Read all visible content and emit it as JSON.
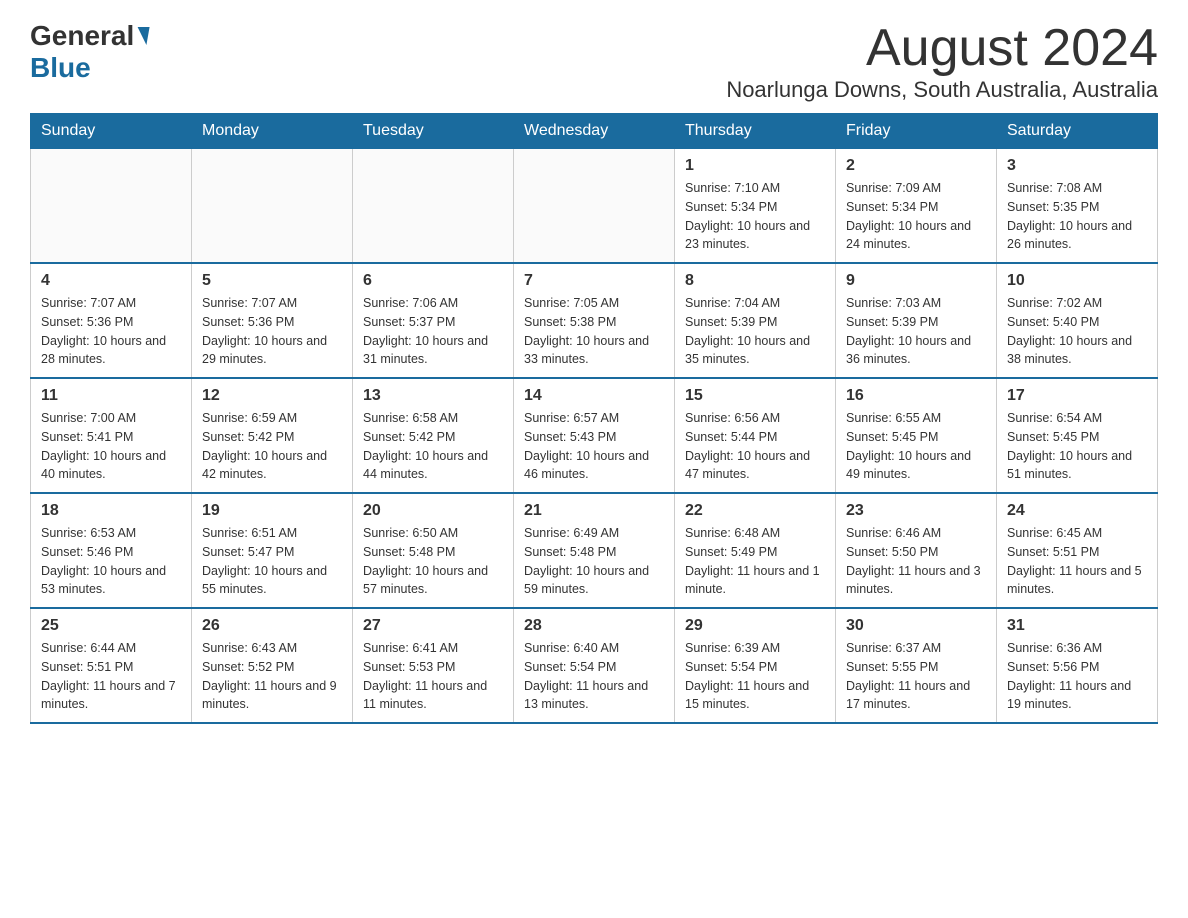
{
  "header": {
    "logo_general": "General",
    "logo_blue": "Blue",
    "month_title": "August 2024",
    "location": "Noarlunga Downs, South Australia, Australia"
  },
  "days_of_week": [
    "Sunday",
    "Monday",
    "Tuesday",
    "Wednesday",
    "Thursday",
    "Friday",
    "Saturday"
  ],
  "weeks": [
    [
      {
        "day": "",
        "info": ""
      },
      {
        "day": "",
        "info": ""
      },
      {
        "day": "",
        "info": ""
      },
      {
        "day": "",
        "info": ""
      },
      {
        "day": "1",
        "info": "Sunrise: 7:10 AM\nSunset: 5:34 PM\nDaylight: 10 hours and 23 minutes."
      },
      {
        "day": "2",
        "info": "Sunrise: 7:09 AM\nSunset: 5:34 PM\nDaylight: 10 hours and 24 minutes."
      },
      {
        "day": "3",
        "info": "Sunrise: 7:08 AM\nSunset: 5:35 PM\nDaylight: 10 hours and 26 minutes."
      }
    ],
    [
      {
        "day": "4",
        "info": "Sunrise: 7:07 AM\nSunset: 5:36 PM\nDaylight: 10 hours and 28 minutes."
      },
      {
        "day": "5",
        "info": "Sunrise: 7:07 AM\nSunset: 5:36 PM\nDaylight: 10 hours and 29 minutes."
      },
      {
        "day": "6",
        "info": "Sunrise: 7:06 AM\nSunset: 5:37 PM\nDaylight: 10 hours and 31 minutes."
      },
      {
        "day": "7",
        "info": "Sunrise: 7:05 AM\nSunset: 5:38 PM\nDaylight: 10 hours and 33 minutes."
      },
      {
        "day": "8",
        "info": "Sunrise: 7:04 AM\nSunset: 5:39 PM\nDaylight: 10 hours and 35 minutes."
      },
      {
        "day": "9",
        "info": "Sunrise: 7:03 AM\nSunset: 5:39 PM\nDaylight: 10 hours and 36 minutes."
      },
      {
        "day": "10",
        "info": "Sunrise: 7:02 AM\nSunset: 5:40 PM\nDaylight: 10 hours and 38 minutes."
      }
    ],
    [
      {
        "day": "11",
        "info": "Sunrise: 7:00 AM\nSunset: 5:41 PM\nDaylight: 10 hours and 40 minutes."
      },
      {
        "day": "12",
        "info": "Sunrise: 6:59 AM\nSunset: 5:42 PM\nDaylight: 10 hours and 42 minutes."
      },
      {
        "day": "13",
        "info": "Sunrise: 6:58 AM\nSunset: 5:42 PM\nDaylight: 10 hours and 44 minutes."
      },
      {
        "day": "14",
        "info": "Sunrise: 6:57 AM\nSunset: 5:43 PM\nDaylight: 10 hours and 46 minutes."
      },
      {
        "day": "15",
        "info": "Sunrise: 6:56 AM\nSunset: 5:44 PM\nDaylight: 10 hours and 47 minutes."
      },
      {
        "day": "16",
        "info": "Sunrise: 6:55 AM\nSunset: 5:45 PM\nDaylight: 10 hours and 49 minutes."
      },
      {
        "day": "17",
        "info": "Sunrise: 6:54 AM\nSunset: 5:45 PM\nDaylight: 10 hours and 51 minutes."
      }
    ],
    [
      {
        "day": "18",
        "info": "Sunrise: 6:53 AM\nSunset: 5:46 PM\nDaylight: 10 hours and 53 minutes."
      },
      {
        "day": "19",
        "info": "Sunrise: 6:51 AM\nSunset: 5:47 PM\nDaylight: 10 hours and 55 minutes."
      },
      {
        "day": "20",
        "info": "Sunrise: 6:50 AM\nSunset: 5:48 PM\nDaylight: 10 hours and 57 minutes."
      },
      {
        "day": "21",
        "info": "Sunrise: 6:49 AM\nSunset: 5:48 PM\nDaylight: 10 hours and 59 minutes."
      },
      {
        "day": "22",
        "info": "Sunrise: 6:48 AM\nSunset: 5:49 PM\nDaylight: 11 hours and 1 minute."
      },
      {
        "day": "23",
        "info": "Sunrise: 6:46 AM\nSunset: 5:50 PM\nDaylight: 11 hours and 3 minutes."
      },
      {
        "day": "24",
        "info": "Sunrise: 6:45 AM\nSunset: 5:51 PM\nDaylight: 11 hours and 5 minutes."
      }
    ],
    [
      {
        "day": "25",
        "info": "Sunrise: 6:44 AM\nSunset: 5:51 PM\nDaylight: 11 hours and 7 minutes."
      },
      {
        "day": "26",
        "info": "Sunrise: 6:43 AM\nSunset: 5:52 PM\nDaylight: 11 hours and 9 minutes."
      },
      {
        "day": "27",
        "info": "Sunrise: 6:41 AM\nSunset: 5:53 PM\nDaylight: 11 hours and 11 minutes."
      },
      {
        "day": "28",
        "info": "Sunrise: 6:40 AM\nSunset: 5:54 PM\nDaylight: 11 hours and 13 minutes."
      },
      {
        "day": "29",
        "info": "Sunrise: 6:39 AM\nSunset: 5:54 PM\nDaylight: 11 hours and 15 minutes."
      },
      {
        "day": "30",
        "info": "Sunrise: 6:37 AM\nSunset: 5:55 PM\nDaylight: 11 hours and 17 minutes."
      },
      {
        "day": "31",
        "info": "Sunrise: 6:36 AM\nSunset: 5:56 PM\nDaylight: 11 hours and 19 minutes."
      }
    ]
  ]
}
